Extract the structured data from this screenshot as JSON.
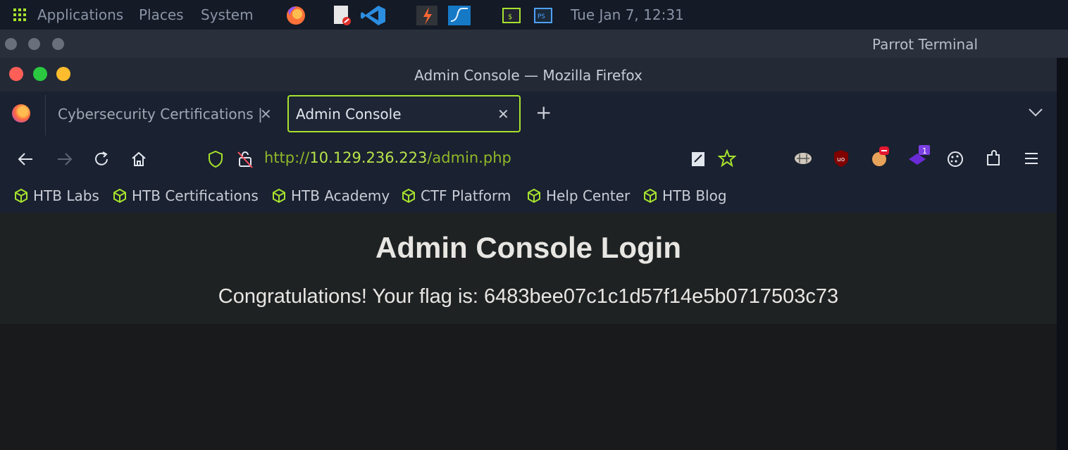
{
  "system_panel": {
    "menus": [
      "Applications",
      "Places",
      "System"
    ],
    "clock": "Tue Jan 7, 12:31"
  },
  "terminal": {
    "title": "Parrot Terminal"
  },
  "firefox": {
    "window_title": "Admin Console — Mozilla Firefox",
    "tabs": [
      {
        "label": "Cybersecurity Certifications |"
      },
      {
        "label": "Admin Console"
      }
    ],
    "url": {
      "scheme": "http://",
      "host": "10.129.236.223",
      "path": "/admin.php"
    },
    "bookmarks": [
      "HTB Labs",
      "HTB Certifications",
      "HTB Academy",
      "CTF Platform",
      "Help Center",
      "HTB Blog"
    ],
    "extension_badge": "1"
  },
  "page": {
    "heading": "Admin Console Login",
    "message": "Congratulations! Your flag is: 6483bee07c1c1d57f14e5b0717503c73"
  },
  "colors": {
    "accent_green": "#a6e22e",
    "panel_bg": "#141a26",
    "page_bg": "#181a1b"
  }
}
